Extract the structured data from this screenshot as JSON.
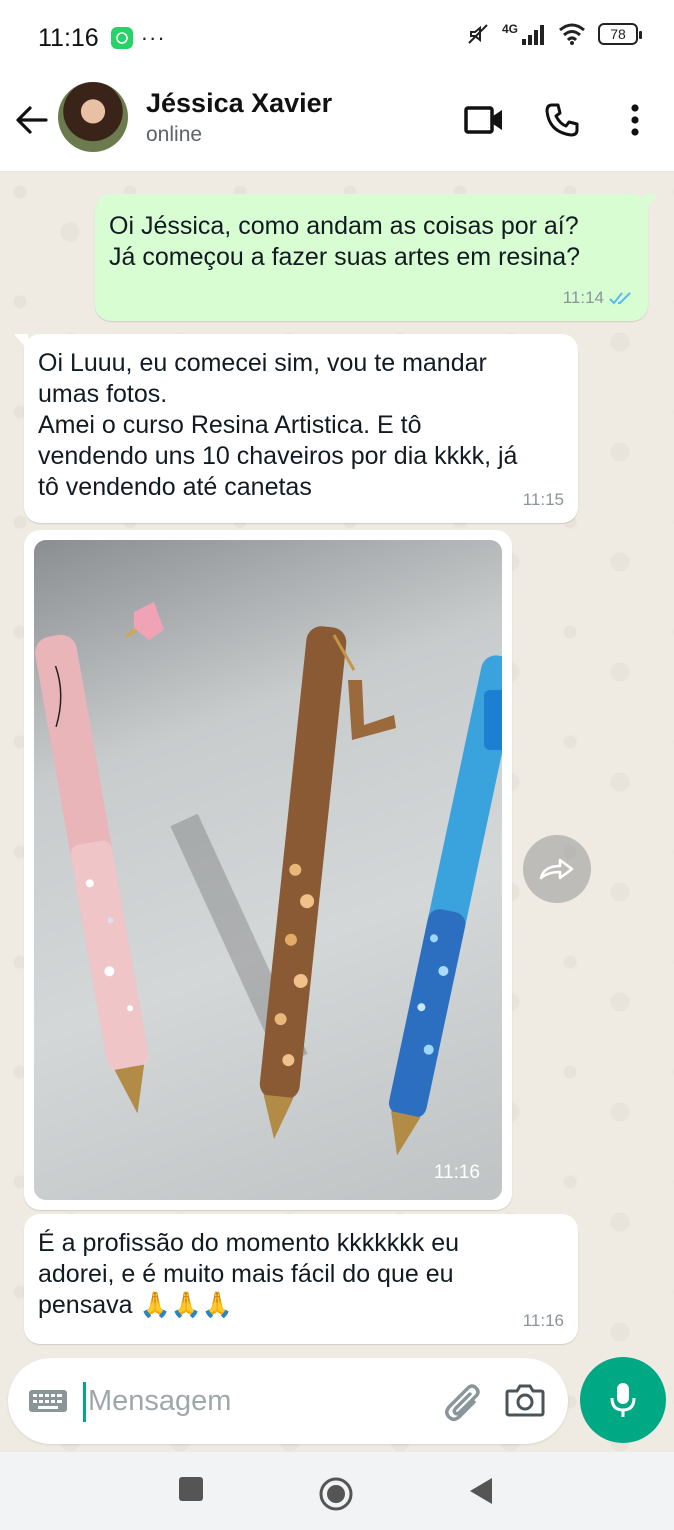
{
  "status_bar": {
    "time": "11:16",
    "dots": "···",
    "network": "4G",
    "battery": "78"
  },
  "header": {
    "contact_name": "Jéssica Xavier",
    "contact_status": "online"
  },
  "messages": [
    {
      "direction": "out",
      "text": "Oi Jéssica, como andam as coisas por aí?\nJá começou a fazer suas artes em resina?",
      "time": "11:14"
    },
    {
      "direction": "in",
      "text": "Oi Luuu, eu comecei sim, vou te mandar\numas fotos.\nAmei o curso Resina Artistica. E tô\nvendendo uns 10 chaveiros por dia kkkk, já\ntô vendendo até canetas",
      "time": "11:15"
    },
    {
      "direction": "in",
      "type": "image",
      "time": "11:16"
    },
    {
      "direction": "in",
      "text": "É a profissão do momento kkkkkkk eu\nadorei, e é muito mais fácil do que eu\npensava 🙏🙏🙏",
      "time": "11:16"
    }
  ],
  "composer": {
    "placeholder": "Mensagem"
  },
  "colors": {
    "accent": "#00a884",
    "outgoing_bubble": "#d9fdd3",
    "chat_background": "#efeae2",
    "read_ticks": "#53bdeb"
  },
  "icons": {
    "back": "arrow-left-icon",
    "video": "video-camera-icon",
    "call": "phone-icon",
    "menu": "more-vertical-icon",
    "keyboard": "keyboard-icon",
    "attach": "paperclip-icon",
    "camera": "camera-icon",
    "mic": "microphone-icon",
    "forward": "forward-icon"
  }
}
